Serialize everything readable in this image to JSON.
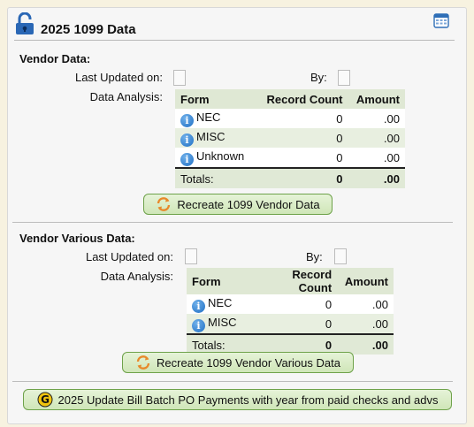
{
  "title": "2025 1099 Data",
  "vendor": {
    "section_label": "Vendor Data:",
    "last_updated_label": "Last Updated on:",
    "by_label": "By:",
    "analysis_label": "Data Analysis:",
    "columns": [
      "Form",
      "Record Count",
      "Amount"
    ],
    "rows": [
      {
        "form": "NEC",
        "count": "0",
        "amount": ".00"
      },
      {
        "form": "MISC",
        "count": "0",
        "amount": ".00"
      },
      {
        "form": "Unknown",
        "count": "0",
        "amount": ".00"
      }
    ],
    "totals": {
      "label": "Totals:",
      "count": "0",
      "amount": ".00"
    },
    "button": "Recreate 1099 Vendor Data"
  },
  "various": {
    "section_label": "Vendor Various Data:",
    "last_updated_label": "Last Updated on:",
    "by_label": "By:",
    "analysis_label": "Data Analysis:",
    "columns": [
      "Form",
      "Record Count",
      "Amount"
    ],
    "rows": [
      {
        "form": "NEC",
        "count": "0",
        "amount": ".00"
      },
      {
        "form": "MISC",
        "count": "0",
        "amount": ".00"
      }
    ],
    "totals": {
      "label": "Totals:",
      "count": "0",
      "amount": ".00"
    },
    "button": "Recreate 1099 Vendor Various Data"
  },
  "update_button": "2025 Update Bill Batch PO Payments with year from paid checks and advs",
  "colors": {
    "accent_green": "#6ea24a",
    "table_bg": "#dfe8d4",
    "lock_blue": "#2a67b5",
    "orange_refresh": "#e8892a"
  }
}
